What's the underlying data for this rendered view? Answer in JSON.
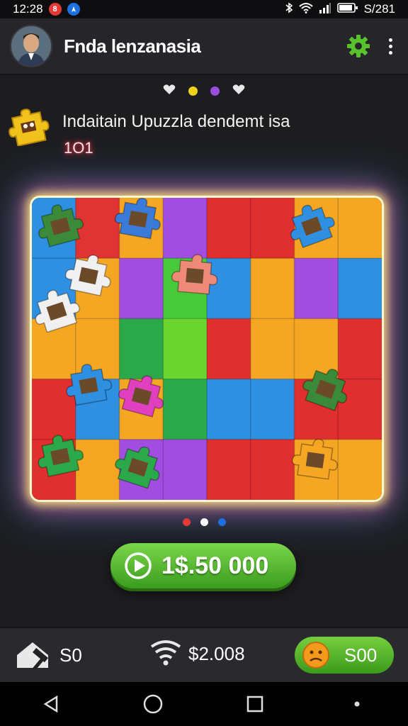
{
  "status_bar": {
    "time": "12:28",
    "notif_count": "8",
    "right_text": "S/281",
    "icons": [
      "bluetooth-icon",
      "wifi-icon",
      "signal-icon",
      "battery-icon"
    ]
  },
  "app_bar": {
    "title": "Fnda lenzanasia",
    "settings_icon": "gear-icon",
    "menu_icon": "more-vert-icon",
    "accent_color": "#57c22c"
  },
  "top_indicators": [
    "heart",
    "#f1d21b",
    "#9a4ee0",
    "heart"
  ],
  "header": {
    "title": "Indaitain Upuzzla dendemt isa",
    "count": "1O1"
  },
  "puzzle": {
    "rows": 5,
    "cols": 8,
    "colors": [
      [
        "#2f8fe0",
        "#e03434",
        "#f5a623",
        "#a14ee0",
        "#e02f2f",
        "#e02f2f",
        "#f5a623",
        "#f5a623"
      ],
      [
        "#2f8fe0",
        "#f5a623",
        "#a14ee0",
        "#47c93a",
        "#2f8fe0",
        "#f5a623",
        "#a14ee0",
        "#2f8fe0"
      ],
      [
        "#f5a623",
        "#f5a623",
        "#2aa84a",
        "#6ad52f",
        "#e02f2f",
        "#f5a623",
        "#f5a623",
        "#e02f2f"
      ],
      [
        "#e02f2f",
        "#2f8fe0",
        "#f5a623",
        "#2aa84a",
        "#2f8fe0",
        "#2f8fe0",
        "#e02f2f",
        "#e02f2f"
      ],
      [
        "#e02f2f",
        "#f5a623",
        "#a14ee0",
        "#a14ee0",
        "#e02f2f",
        "#e02f2f",
        "#f5a623",
        "#f5a623"
      ]
    ]
  },
  "pager_dots": [
    "#e53935",
    "#ffffff",
    "#1e6fe0"
  ],
  "play_button": {
    "label": "1$.50 000",
    "icon": "play-circle-icon"
  },
  "bottom_bar": {
    "item1": {
      "icon": "house-hammer-icon",
      "value": "S0"
    },
    "item2": {
      "icon": "wifi-wing-icon",
      "value": "$2.008"
    },
    "item3": {
      "icon": "smiley-face-icon",
      "value": "S00"
    }
  },
  "nav": [
    "back-icon",
    "home-icon",
    "recents-icon",
    "dot-icon"
  ]
}
